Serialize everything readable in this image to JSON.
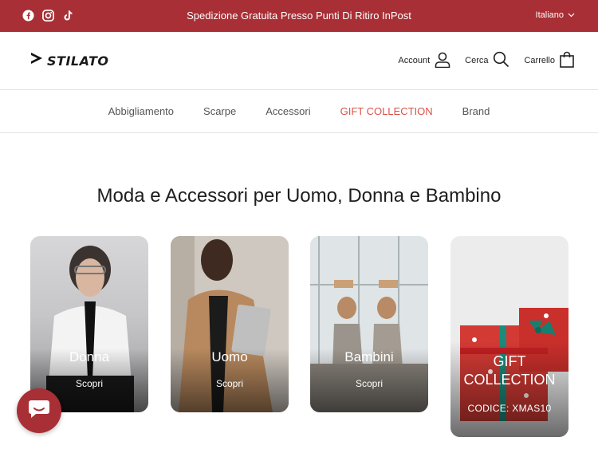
{
  "announcement": {
    "message": "Spedizione Gratuita Presso Punti Di Ritiro InPost",
    "language": "Italiano",
    "socials": [
      "facebook-icon",
      "instagram-icon",
      "tiktok-icon"
    ]
  },
  "header": {
    "logo_text": "STILATO",
    "account_label": "Account",
    "search_label": "Cerca",
    "cart_label": "Carrello"
  },
  "nav": {
    "items": [
      {
        "label": "Abbigliamento"
      },
      {
        "label": "Scarpe"
      },
      {
        "label": "Accessori"
      },
      {
        "label": "GIFT COLLECTION"
      },
      {
        "label": "Brand"
      }
    ]
  },
  "hero": {
    "title": "Moda e Accessori per Uomo, Donna e Bambino"
  },
  "cards": [
    {
      "label": "Donna",
      "cta": "Scopri"
    },
    {
      "label": "Uomo",
      "cta": "Scopri"
    },
    {
      "label": "Bambini",
      "cta": "Scopri"
    },
    {
      "label": "GIFT COLLECTION",
      "cta": "CODICE: XMAS10"
    }
  ],
  "colors": {
    "brand": "#a82f35",
    "accent_nav": "#d9534a"
  }
}
